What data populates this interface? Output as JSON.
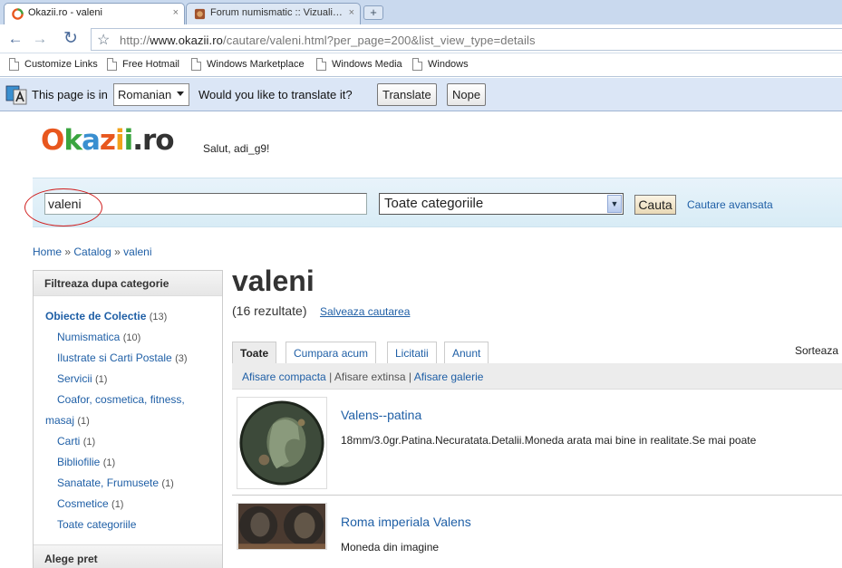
{
  "tabs": [
    {
      "title": "Okazii.ro - valeni",
      "close": "×"
    },
    {
      "title": "Forum numismatic :: Vizuali…",
      "close": "×"
    }
  ],
  "new_tab": "+",
  "address": {
    "prefix": "http://",
    "host": "www.okazii.ro",
    "path": "/cautare/valeni.html?per_page=200&list_view_type=details"
  },
  "nav": {
    "back": "←",
    "forward": "→",
    "reload": "↻",
    "star": "☆"
  },
  "bookmarks": [
    "Customize Links",
    "Free Hotmail",
    "Windows Marketplace",
    "Windows Media",
    "Windows"
  ],
  "translate_bar": {
    "prefix": "This page is in",
    "language": "Romanian",
    "question": "Would you like to translate it?",
    "translate_btn": "Translate",
    "nope_btn": "Nope"
  },
  "site": {
    "logo": {
      "letters": [
        "O",
        "k",
        "a",
        "z",
        "i",
        "i",
        ".ro"
      ],
      "colors": [
        "#e8571e",
        "#3aa53f",
        "#3a8fd0",
        "#e8571e",
        "#f1a21b",
        "#3aa53f",
        "#333333"
      ]
    },
    "greeting": "Salut, adi_g9!"
  },
  "search": {
    "query": "valeni",
    "category": "Toate categoriile",
    "button": "Cauta",
    "advanced": "Cautare avansata"
  },
  "breadcrumb": {
    "home": "Home",
    "sep": "»",
    "catalog": "Catalog",
    "current": "valeni"
  },
  "sidebar": {
    "heading": "Filtreaza dupa categorie",
    "main": {
      "label": "Obiecte de Colectie",
      "count": "(13)"
    },
    "items": [
      {
        "label": "Numismatica",
        "count": "(10)"
      },
      {
        "label": "Ilustrate si Carti Postale",
        "count": "(3)"
      },
      {
        "label": "Servicii",
        "count": "(1)"
      },
      {
        "label": "Coafor, cosmetica, fitness,",
        "label2": "masaj",
        "count": "(1)"
      },
      {
        "label": "Carti",
        "count": "(1)"
      },
      {
        "label": "Bibliofilie",
        "count": "(1)"
      },
      {
        "label": "Sanatate, Frumusete",
        "count": "(1)"
      },
      {
        "label": "Cosmetice",
        "count": "(1)"
      },
      {
        "label": "Toate categoriile",
        "count": ""
      }
    ],
    "price_heading": "Alege pret"
  },
  "main": {
    "title": "valeni",
    "results": "(16 rezultate)",
    "save_search": "Salveaza cautarea",
    "tabs": [
      "Toate",
      "Cumpara acum",
      "Licitatii",
      "Anunt"
    ],
    "sort_label": "Sorteaza",
    "views": {
      "compact": "Afisare compacta",
      "extended": "Afisare extinsa",
      "gallery": "Afisare galerie",
      "sep": "|"
    },
    "listings": [
      {
        "title": "Valens--patina",
        "desc": "18mm/3.0gr.Patina.Necuratata.Detalii.Moneda arata mai bine in realitate.Se mai poate"
      },
      {
        "title": "Roma imperiala Valens",
        "desc": "Moneda din imagine"
      }
    ]
  }
}
